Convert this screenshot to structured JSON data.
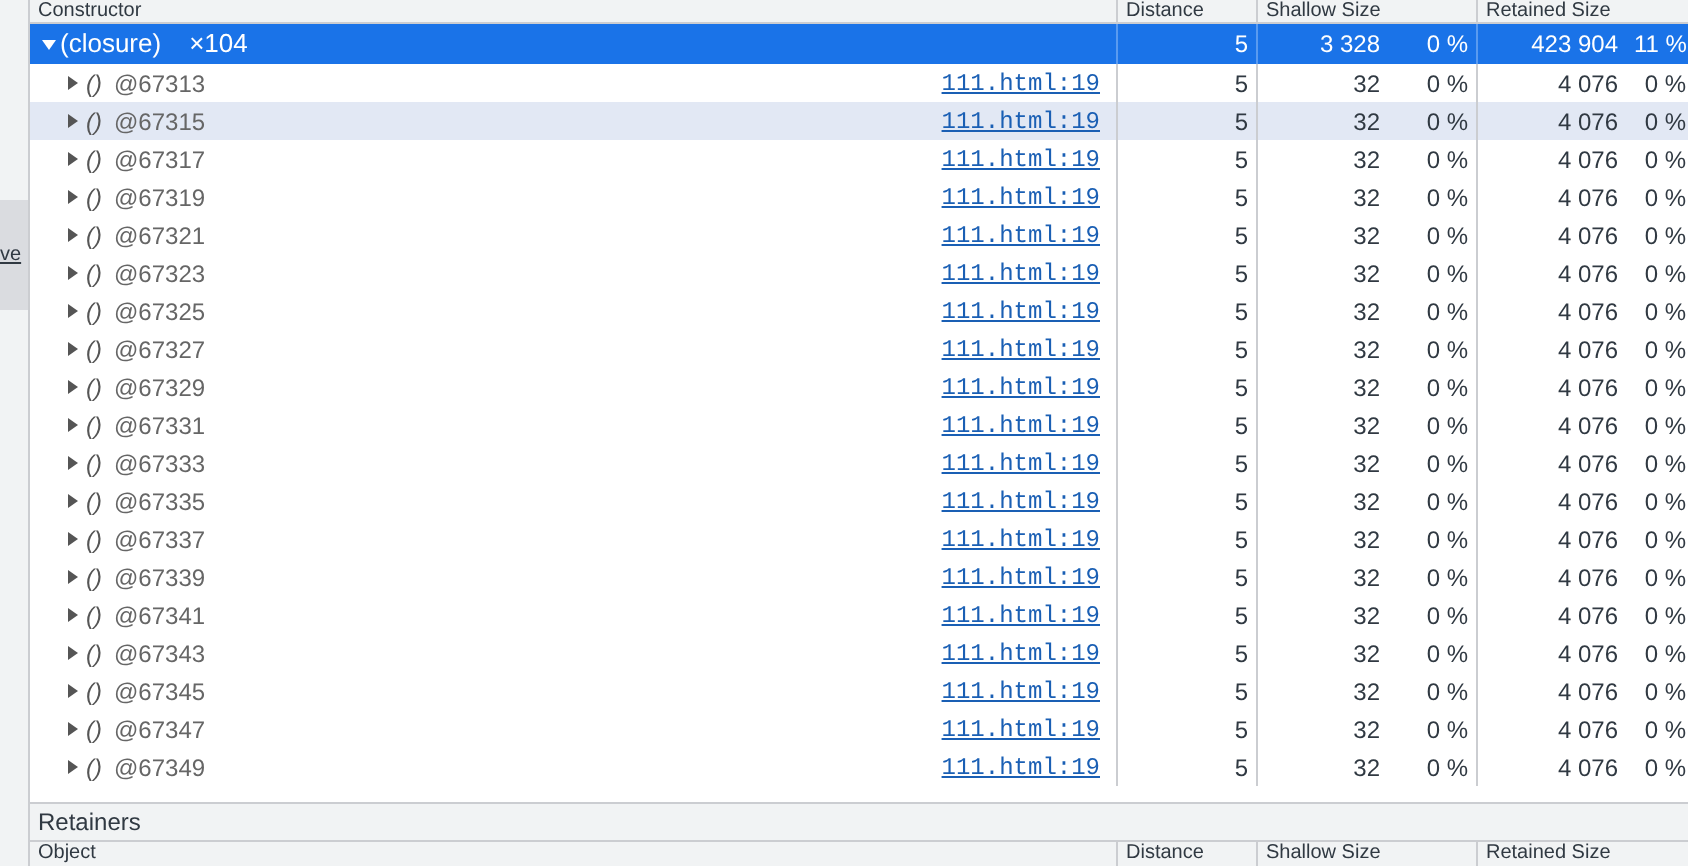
{
  "side_panel": {
    "text": "ve"
  },
  "columns": [
    "Constructor",
    "Distance",
    "Shallow Size",
    "Retained Size"
  ],
  "group": {
    "name": "(closure)",
    "count": "×104",
    "expanded": true,
    "selected": true,
    "distance": "5",
    "shallow": "3 328",
    "shallow_pct": "0 %",
    "retained": "423 904",
    "retained_pct": "11 %"
  },
  "rows": [
    {
      "name": "()",
      "id": "@67313",
      "link": "111.html:19",
      "distance": "5",
      "shallow": "32",
      "shallow_pct": "0 %",
      "retained": "4 076",
      "retained_pct": "0 %",
      "expanded": false,
      "hovered": false
    },
    {
      "name": "()",
      "id": "@67315",
      "link": "111.html:19",
      "distance": "5",
      "shallow": "32",
      "shallow_pct": "0 %",
      "retained": "4 076",
      "retained_pct": "0 %",
      "expanded": false,
      "hovered": true
    },
    {
      "name": "()",
      "id": "@67317",
      "link": "111.html:19",
      "distance": "5",
      "shallow": "32",
      "shallow_pct": "0 %",
      "retained": "4 076",
      "retained_pct": "0 %",
      "expanded": false,
      "hovered": false
    },
    {
      "name": "()",
      "id": "@67319",
      "link": "111.html:19",
      "distance": "5",
      "shallow": "32",
      "shallow_pct": "0 %",
      "retained": "4 076",
      "retained_pct": "0 %",
      "expanded": false,
      "hovered": false
    },
    {
      "name": "()",
      "id": "@67321",
      "link": "111.html:19",
      "distance": "5",
      "shallow": "32",
      "shallow_pct": "0 %",
      "retained": "4 076",
      "retained_pct": "0 %",
      "expanded": false,
      "hovered": false
    },
    {
      "name": "()",
      "id": "@67323",
      "link": "111.html:19",
      "distance": "5",
      "shallow": "32",
      "shallow_pct": "0 %",
      "retained": "4 076",
      "retained_pct": "0 %",
      "expanded": false,
      "hovered": false
    },
    {
      "name": "()",
      "id": "@67325",
      "link": "111.html:19",
      "distance": "5",
      "shallow": "32",
      "shallow_pct": "0 %",
      "retained": "4 076",
      "retained_pct": "0 %",
      "expanded": false,
      "hovered": false
    },
    {
      "name": "()",
      "id": "@67327",
      "link": "111.html:19",
      "distance": "5",
      "shallow": "32",
      "shallow_pct": "0 %",
      "retained": "4 076",
      "retained_pct": "0 %",
      "expanded": false,
      "hovered": false
    },
    {
      "name": "()",
      "id": "@67329",
      "link": "111.html:19",
      "distance": "5",
      "shallow": "32",
      "shallow_pct": "0 %",
      "retained": "4 076",
      "retained_pct": "0 %",
      "expanded": false,
      "hovered": false
    },
    {
      "name": "()",
      "id": "@67331",
      "link": "111.html:19",
      "distance": "5",
      "shallow": "32",
      "shallow_pct": "0 %",
      "retained": "4 076",
      "retained_pct": "0 %",
      "expanded": false,
      "hovered": false
    },
    {
      "name": "()",
      "id": "@67333",
      "link": "111.html:19",
      "distance": "5",
      "shallow": "32",
      "shallow_pct": "0 %",
      "retained": "4 076",
      "retained_pct": "0 %",
      "expanded": false,
      "hovered": false
    },
    {
      "name": "()",
      "id": "@67335",
      "link": "111.html:19",
      "distance": "5",
      "shallow": "32",
      "shallow_pct": "0 %",
      "retained": "4 076",
      "retained_pct": "0 %",
      "expanded": false,
      "hovered": false
    },
    {
      "name": "()",
      "id": "@67337",
      "link": "111.html:19",
      "distance": "5",
      "shallow": "32",
      "shallow_pct": "0 %",
      "retained": "4 076",
      "retained_pct": "0 %",
      "expanded": false,
      "hovered": false
    },
    {
      "name": "()",
      "id": "@67339",
      "link": "111.html:19",
      "distance": "5",
      "shallow": "32",
      "shallow_pct": "0 %",
      "retained": "4 076",
      "retained_pct": "0 %",
      "expanded": false,
      "hovered": false
    },
    {
      "name": "()",
      "id": "@67341",
      "link": "111.html:19",
      "distance": "5",
      "shallow": "32",
      "shallow_pct": "0 %",
      "retained": "4 076",
      "retained_pct": "0 %",
      "expanded": false,
      "hovered": false
    },
    {
      "name": "()",
      "id": "@67343",
      "link": "111.html:19",
      "distance": "5",
      "shallow": "32",
      "shallow_pct": "0 %",
      "retained": "4 076",
      "retained_pct": "0 %",
      "expanded": false,
      "hovered": false
    },
    {
      "name": "()",
      "id": "@67345",
      "link": "111.html:19",
      "distance": "5",
      "shallow": "32",
      "shallow_pct": "0 %",
      "retained": "4 076",
      "retained_pct": "0 %",
      "expanded": false,
      "hovered": false
    },
    {
      "name": "()",
      "id": "@67347",
      "link": "111.html:19",
      "distance": "5",
      "shallow": "32",
      "shallow_pct": "0 %",
      "retained": "4 076",
      "retained_pct": "0 %",
      "expanded": false,
      "hovered": false
    },
    {
      "name": "()",
      "id": "@67349",
      "link": "111.html:19",
      "distance": "5",
      "shallow": "32",
      "shallow_pct": "0 %",
      "retained": "4 076",
      "retained_pct": "0 %",
      "expanded": false,
      "hovered": false
    }
  ],
  "retainers": {
    "title": "Retainers",
    "columns": [
      "Object",
      "Distance",
      "Shallow Size",
      "Retained Size"
    ]
  }
}
